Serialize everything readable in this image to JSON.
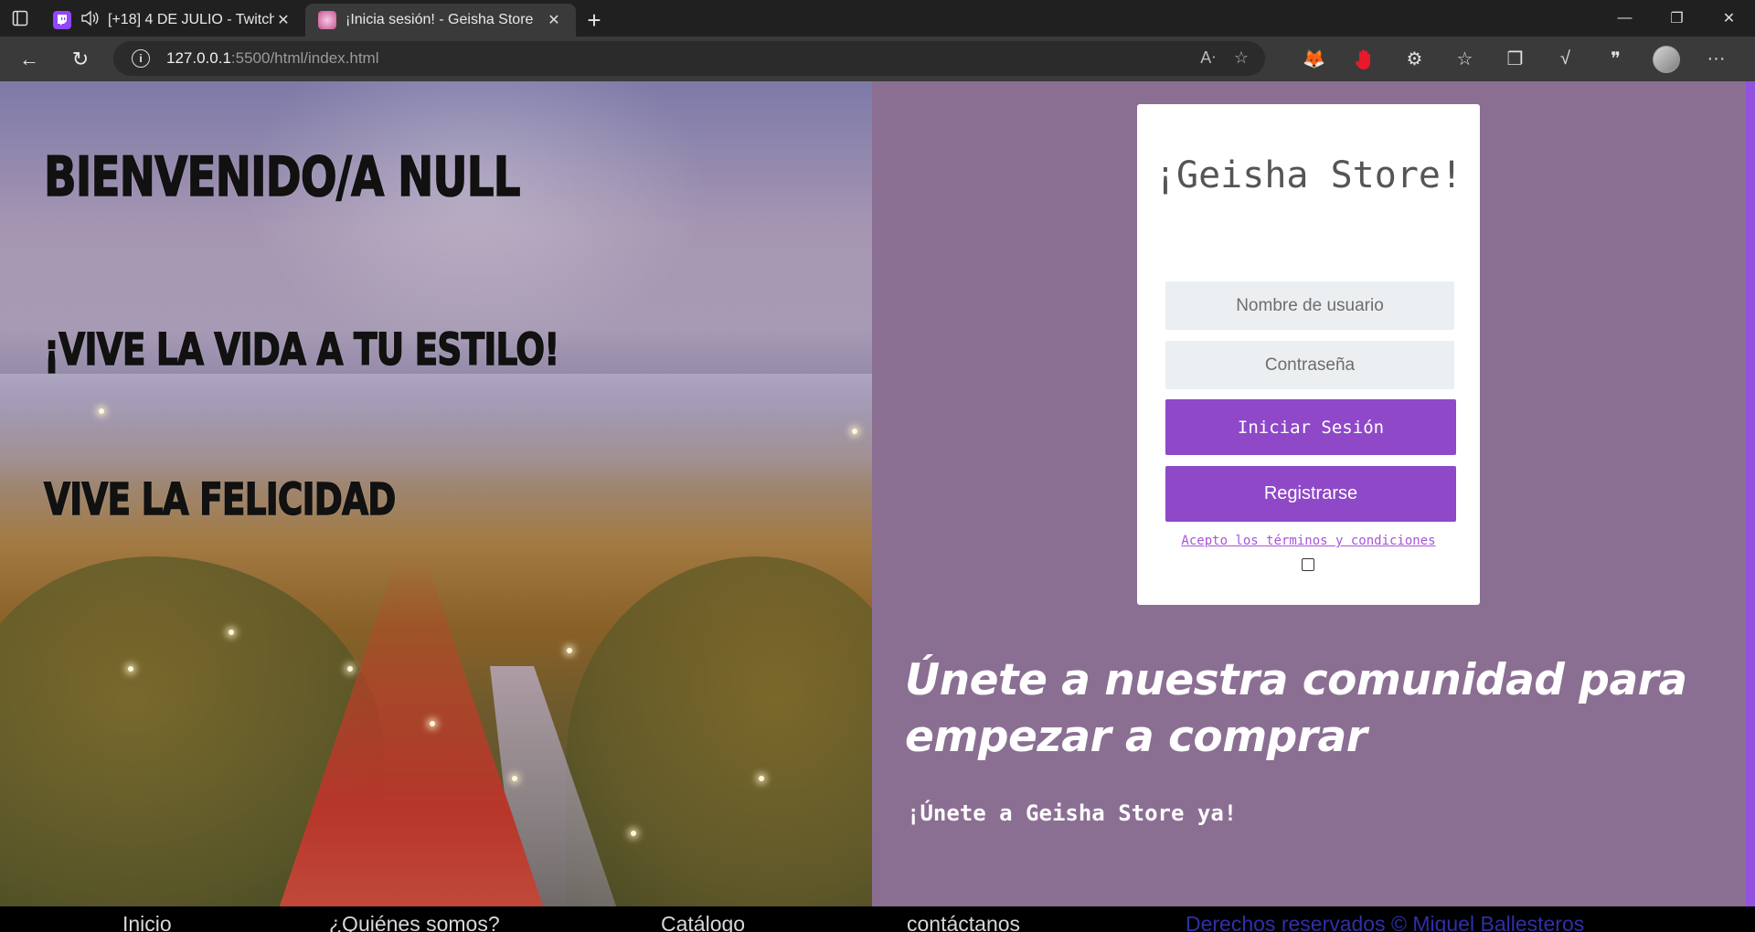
{
  "browser": {
    "tabs": [
      {
        "title": "[+18] 4 DE JULIO - Twitch",
        "favicon": "twitch-icon",
        "audio": true,
        "active": false
      },
      {
        "title": "¡Inicia sesión! - Geisha Store",
        "favicon": "geisha-favicon",
        "active": true
      }
    ],
    "url_host": "127.0.0.1",
    "url_path": ":5500/html/index.html"
  },
  "hero": {
    "welcome": "BIENVENIDO/A NULL",
    "live_style": "¡VIVE LA VIDA A TU ESTILO!",
    "happiness": "VIVE LA FELICIDAD"
  },
  "login": {
    "title": "¡Geisha Store!",
    "username_placeholder": "Nombre de usuario",
    "password_placeholder": "Contraseña",
    "login_button": "Iniciar Sesión",
    "register_button": "Registrarse",
    "terms_link": "Acepto los términos y condiciones",
    "terms_checked": false
  },
  "promo": {
    "headline": "Únete a nuestra comunidad para empezar a comprar",
    "subtitle": "¡Únete a Geisha Store ya!"
  },
  "footer": {
    "links": [
      "Inicio",
      "¿Quiénes somos?",
      "Catálogo",
      "contáctanos"
    ],
    "copyright": "Derechos reservados © Miguel Ballesteros"
  },
  "colors": {
    "panel_bg": "#8b6f93",
    "button": "#8e48c8",
    "accent_bar": "#9352dd",
    "link": "#a855d8"
  }
}
